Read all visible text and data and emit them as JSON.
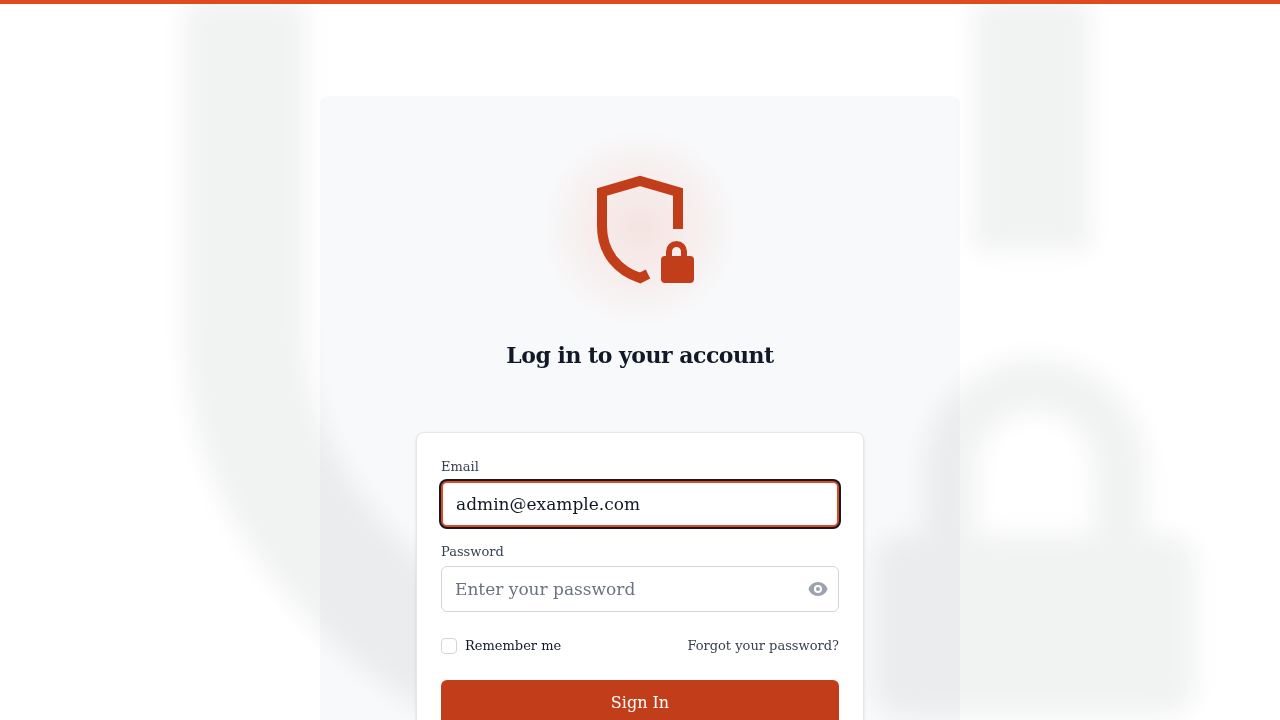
{
  "heading": "Log in to your account",
  "form": {
    "fields": [
      {
        "kind": "email",
        "label": "Email",
        "value": "admin@example.com",
        "focused": true
      },
      {
        "kind": "password",
        "label": "Password",
        "placeholder": "Enter your password",
        "focused": false
      }
    ],
    "remember_me": {
      "label": "Remember me",
      "checked": false
    },
    "forgot_link": "Forgot your password?",
    "submit_button": "Sign In"
  }
}
